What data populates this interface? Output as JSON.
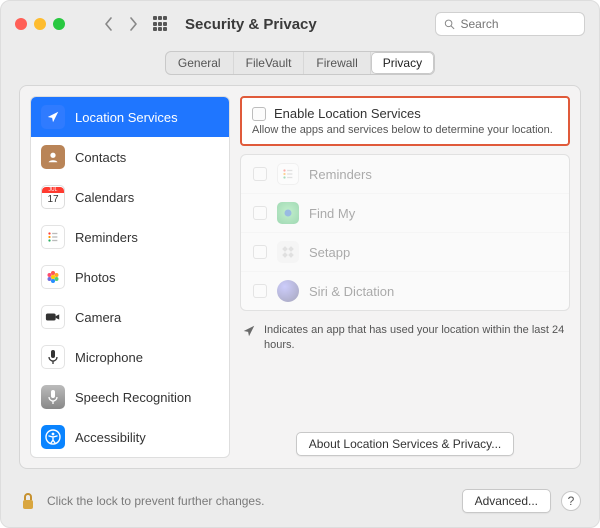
{
  "window": {
    "title": "Security & Privacy",
    "search_placeholder": "Search"
  },
  "tabs": {
    "items": [
      "General",
      "FileVault",
      "Firewall",
      "Privacy"
    ],
    "active_index": 3
  },
  "sidebar": {
    "items": [
      {
        "label": "Location Services"
      },
      {
        "label": "Contacts"
      },
      {
        "label": "Calendars"
      },
      {
        "label": "Reminders"
      },
      {
        "label": "Photos"
      },
      {
        "label": "Camera"
      },
      {
        "label": "Microphone"
      },
      {
        "label": "Speech Recognition"
      },
      {
        "label": "Accessibility"
      }
    ],
    "selected_index": 0,
    "calendar_day": "17"
  },
  "panel": {
    "enable_label": "Enable Location Services",
    "enable_sub": "Allow the apps and services below to determine your location.",
    "apps": [
      {
        "label": "Reminders"
      },
      {
        "label": "Find My"
      },
      {
        "label": "Setapp"
      },
      {
        "label": "Siri & Dictation"
      }
    ],
    "note": "Indicates an app that has used your location within the last 24 hours.",
    "about_button": "About Location Services & Privacy..."
  },
  "footer": {
    "lock_text": "Click the lock to prevent further changes.",
    "advanced": "Advanced...",
    "help": "?"
  }
}
